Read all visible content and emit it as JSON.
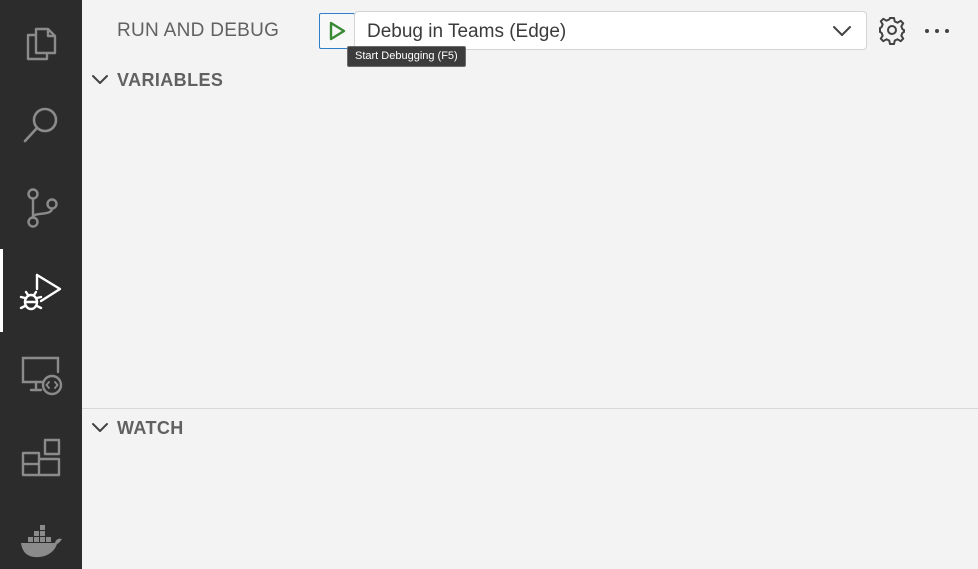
{
  "activity_bar": {
    "items": [
      {
        "icon": "files-icon",
        "active": false
      },
      {
        "icon": "search-icon",
        "active": false
      },
      {
        "icon": "source-control-icon",
        "active": false
      },
      {
        "icon": "run-debug-icon",
        "active": true
      },
      {
        "icon": "remote-explorer-icon",
        "active": false
      },
      {
        "icon": "extensions-icon",
        "active": false
      },
      {
        "icon": "docker-icon",
        "active": false
      }
    ]
  },
  "header": {
    "title": "RUN AND DEBUG",
    "configuration": "Debug in Teams (Edge)",
    "tooltip": "Start Debugging (F5)"
  },
  "sections": {
    "variables": {
      "title": "VARIABLES",
      "expanded": true
    },
    "watch": {
      "title": "WATCH",
      "expanded": true
    }
  },
  "colors": {
    "activity_bar_bg": "#2c2c2c",
    "sidebar_bg": "#f3f3f3",
    "play_green": "#388a34",
    "focus_border": "#2f7fc8"
  }
}
